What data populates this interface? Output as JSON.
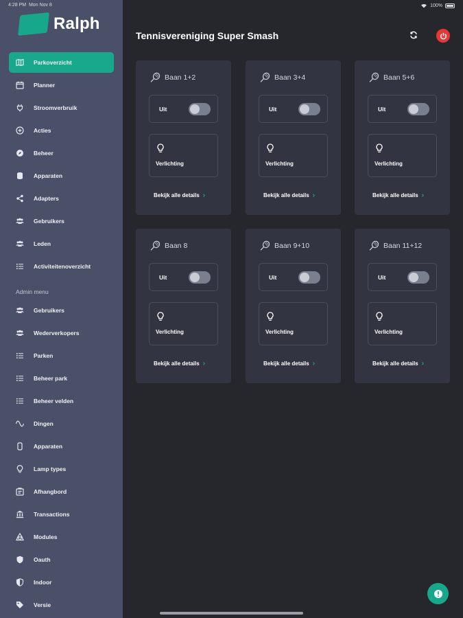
{
  "status_bar": {
    "time": "4:28 PM",
    "date": "Mon Nov 8",
    "battery": "100%"
  },
  "app": {
    "name": "Ralph",
    "brand_color": "#19a88c"
  },
  "sidebar": {
    "items": [
      {
        "label": "Parkoverzicht",
        "icon": "map-icon",
        "active": true
      },
      {
        "label": "Planner",
        "icon": "calendar-icon"
      },
      {
        "label": "Stroomverbruik",
        "icon": "plug-icon"
      },
      {
        "label": "Acties",
        "icon": "plus-circle-icon"
      },
      {
        "label": "Beheer",
        "icon": "compass-icon"
      },
      {
        "label": "Apparaten",
        "icon": "database-icon"
      },
      {
        "label": "Adapters",
        "icon": "share-icon"
      },
      {
        "label": "Gebruikers",
        "icon": "users-icon"
      },
      {
        "label": "Leden",
        "icon": "users-icon"
      },
      {
        "label": "Activiteitenoverzicht",
        "icon": "list-icon"
      }
    ],
    "admin_title": "Admin menu",
    "admin_items": [
      {
        "label": "Gebruikers",
        "icon": "users-icon"
      },
      {
        "label": "Wederverkopers",
        "icon": "users-icon"
      },
      {
        "label": "Parken",
        "icon": "list-icon"
      },
      {
        "label": "Beheer park",
        "icon": "list-icon"
      },
      {
        "label": "Beheer velden",
        "icon": "list-icon"
      },
      {
        "label": "Dingen",
        "icon": "wave-icon"
      },
      {
        "label": "Apparaten",
        "icon": "device-icon"
      },
      {
        "label": "Lamp types",
        "icon": "bulb-icon"
      },
      {
        "label": "Afhangbord",
        "icon": "board-icon"
      },
      {
        "label": "Transactions",
        "icon": "bank-icon"
      },
      {
        "label": "Modules",
        "icon": "modules-icon"
      },
      {
        "label": "Oauth",
        "icon": "shield-icon"
      },
      {
        "label": "Indoor",
        "icon": "shield-half-icon"
      },
      {
        "label": "Versie",
        "icon": "tag-icon"
      }
    ]
  },
  "main": {
    "title": "Tennisvereniging Super Smash",
    "courts": [
      {
        "name": "Baan 1+2",
        "toggle_label": "Uit",
        "light_label": "Verlichting",
        "details_label": "Bekijk alle details"
      },
      {
        "name": "Baan 3+4",
        "toggle_label": "Uit",
        "light_label": "Verlichting",
        "details_label": "Bekijk alle details"
      },
      {
        "name": "Baan 5+6",
        "toggle_label": "Uit",
        "light_label": "Verlichting",
        "details_label": "Bekijk alle details"
      },
      {
        "name": "Baan 8",
        "toggle_label": "Uit",
        "light_label": "Verlichting",
        "details_label": "Bekijk alle details"
      },
      {
        "name": "Baan 9+10",
        "toggle_label": "Uit",
        "light_label": "Verlichting",
        "details_label": "Bekijk alle details"
      },
      {
        "name": "Baan 11+12",
        "toggle_label": "Uit",
        "light_label": "Verlichting",
        "details_label": "Bekijk alle details"
      }
    ]
  }
}
